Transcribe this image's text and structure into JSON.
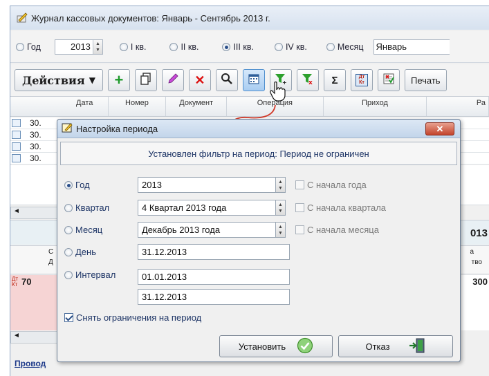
{
  "window": {
    "title": "Журнал кассовых документов: Январь - Сентябрь 2013 г."
  },
  "period_bar": {
    "year_label": "Год",
    "year_value": "2013",
    "q1_label": "I кв.",
    "q2_label": "II кв.",
    "q3_label": "III кв.",
    "q4_label": "IV кв.",
    "month_label": "Месяц",
    "month_value": "Январь",
    "selected": "III кв."
  },
  "toolbar": {
    "actions_label": "Действия",
    "sigma_label": "Σ",
    "dtkt_label": "Дт Кт",
    "print_label": "Печать"
  },
  "grid": {
    "columns": [
      "Дата",
      "Номер",
      "Документ",
      "Операция",
      "Приход",
      "Ра"
    ],
    "rows": [
      "30.",
      "30.",
      "30.",
      "30."
    ],
    "year_fragment": "013",
    "side_col1": "С",
    "side_col1b": "Д",
    "side_col2": "а",
    "side_col2b": "тво",
    "cell_70": "70",
    "cell_300": "300",
    "dtkt_small": "Дт Кт",
    "bottom_link": "Провод"
  },
  "dialog": {
    "title": "Настройка периода",
    "close_label": "✕",
    "filter_text": "Установлен фильтр на период: Период не ограничен",
    "year_label": "Год",
    "year_value": "2013",
    "quarter_label": "Квартал",
    "quarter_value": "4 Квартал 2013 года",
    "month_label": "Месяц",
    "month_value": "Декабрь 2013 года",
    "day_label": "День",
    "day_value": "31.12.2013",
    "interval_label": "Интервал",
    "interval_from": "01.01.2013",
    "interval_to": "31.12.2013",
    "chk_year": "С начала года",
    "chk_quarter": "С начала квартала",
    "chk_month": "С начала месяца",
    "remove_limits": "Снять ограничения на период",
    "remove_limits_checked": true,
    "selected": "Год",
    "set_button": "Установить",
    "cancel_button": "Отказ"
  }
}
